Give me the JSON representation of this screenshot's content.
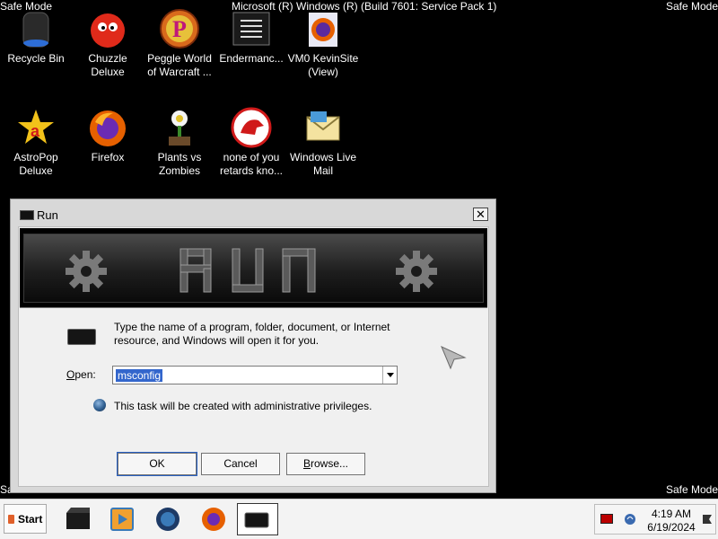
{
  "desktop": {
    "overlay": {
      "safe_mode": "Safe Mode",
      "build": "Microsoft (R) Windows (R) (Build 7601: Service Pack 1)"
    },
    "icons": [
      {
        "label": "Recycle Bin",
        "icon": "recycle-bin-icon"
      },
      {
        "label": "Chuzzle Deluxe",
        "icon": "chuzzle-icon"
      },
      {
        "label": "Peggle World of Warcraft ...",
        "icon": "peggle-icon"
      },
      {
        "label": "Endermanc...",
        "icon": "document-icon"
      },
      {
        "label": "VM0 KevinSite (View)",
        "icon": "firefox-shortcut-icon"
      },
      {
        "label": "AstroPop Deluxe",
        "icon": "astropop-icon"
      },
      {
        "label": "Firefox",
        "icon": "firefox-icon"
      },
      {
        "label": "Plants vs Zombies",
        "icon": "plants-vs-zombies-icon"
      },
      {
        "label": "none of you retards kno...",
        "icon": "red-dinosaur-icon"
      },
      {
        "label": "Windows Live Mail",
        "icon": "windows-live-mail-icon"
      }
    ]
  },
  "run_dialog": {
    "title": "Run",
    "close_label": "✕",
    "banner_word": "RUN",
    "prompt": "Type the name of a program, folder, document, or Internet resource, and Windows will open it for you.",
    "open_label": "Open:",
    "open_value": "msconfig",
    "admin_note": "This task will be created with administrative privileges.",
    "buttons": {
      "ok": "OK",
      "cancel": "Cancel",
      "browse": "Browse..."
    }
  },
  "taskbar": {
    "start_label": "Start",
    "pinned": [
      "projector-icon",
      "media-player-icon",
      "globe-icon",
      "firefox-icon",
      "run-icon"
    ],
    "clock": {
      "time": "4:19 AM",
      "date": "6/19/2024"
    }
  },
  "colors": {
    "selection": "#3366cc",
    "firefox_orange": "#e66000",
    "desktop": "#000000"
  }
}
